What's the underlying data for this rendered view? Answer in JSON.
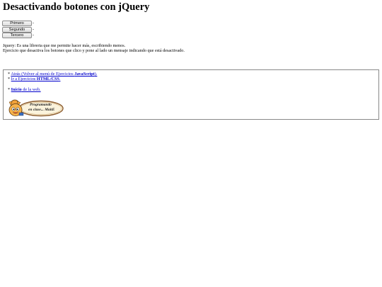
{
  "page": {
    "title": "Desactivando botones con jQuery"
  },
  "buttons": [
    {
      "label": "Primero",
      "message": "-"
    },
    {
      "label": "Segundo",
      "message": "-"
    },
    {
      "label": "Tercero",
      "message": "-"
    }
  ],
  "description": {
    "line1": "Jquery: Es una libreria que me permite hacer más, escribiendo menos.",
    "line2": "Ejercicio que desactiva los botones que clico y pone al lado un mensaje indicando que está desactivado."
  },
  "nav": {
    "back": {
      "bullet": "*",
      "pre": "Atrás (Volver al menú de Ejercicios ",
      "bold": "JavaScript",
      "post": ")."
    },
    "css": {
      "bullet": "*",
      "pre": "Ir a Ejercicios ",
      "bold": "HTML/CSS",
      "post": "."
    },
    "home": {
      "bullet": "*",
      "bold": "Inicio",
      "post": " de la web."
    }
  },
  "logo": {
    "text_line1": "Programando",
    "text_line2": "en clase... MaitE"
  }
}
